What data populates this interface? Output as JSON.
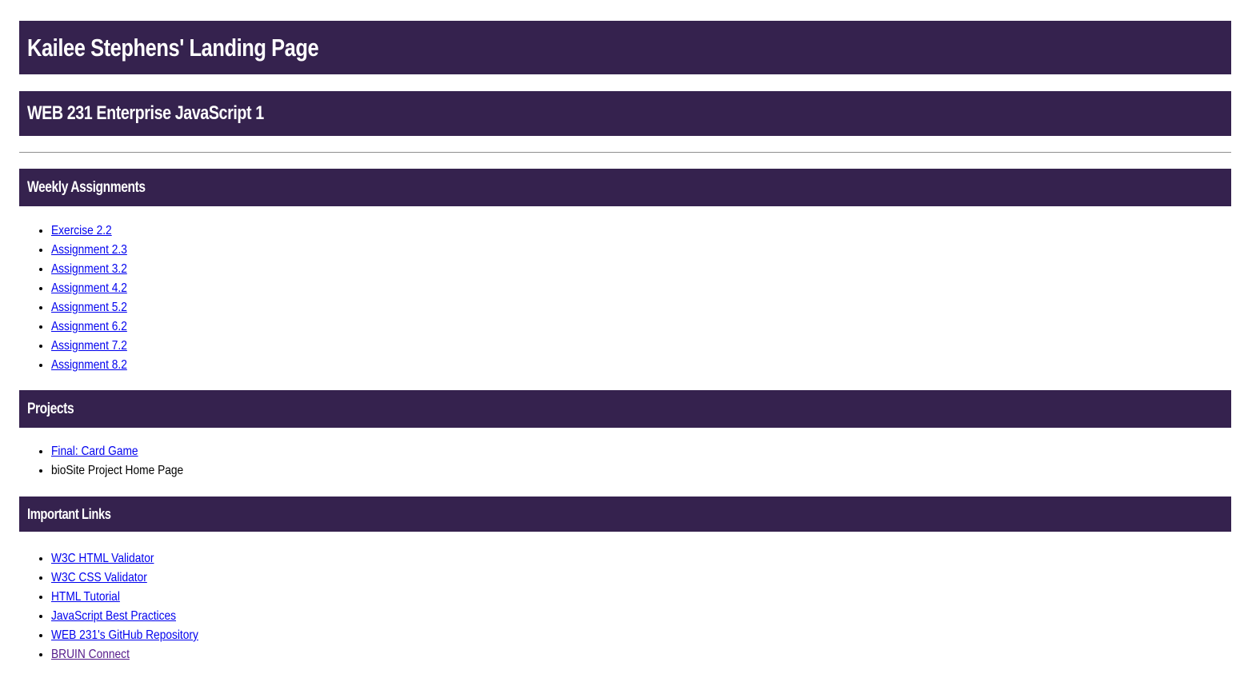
{
  "header": {
    "title": "Kailee Stephens' Landing Page",
    "subtitle": "WEB 231 Enterprise JavaScript 1"
  },
  "sections": {
    "weekly": {
      "heading": "Weekly Assignments",
      "items": [
        {
          "label": "Exercise 2.2"
        },
        {
          "label": "Assignment 2.3"
        },
        {
          "label": "Assignment 3.2"
        },
        {
          "label": "Assignment 4.2"
        },
        {
          "label": "Assignment 5.2"
        },
        {
          "label": "Assignment 6.2"
        },
        {
          "label": "Assignment 7.2"
        },
        {
          "label": "Assignment 8.2"
        }
      ]
    },
    "projects": {
      "heading": "Projects",
      "items": [
        {
          "label": "Final: Card Game"
        },
        {
          "label": "bioSite Project Home Page"
        }
      ]
    },
    "links": {
      "heading": "Important Links",
      "items": [
        {
          "label": "W3C HTML Validator"
        },
        {
          "label": "W3C CSS Validator"
        },
        {
          "label": "HTML Tutorial"
        },
        {
          "label": "JavaScript Best Practices"
        },
        {
          "label": "WEB 231's GitHub Repository"
        },
        {
          "label": "BRUIN Connect"
        }
      ]
    }
  },
  "colors": {
    "banner_background": "#35224e",
    "banner_text": "#ffffff",
    "link": "#0000ee",
    "visited_link": "#551a8b"
  }
}
